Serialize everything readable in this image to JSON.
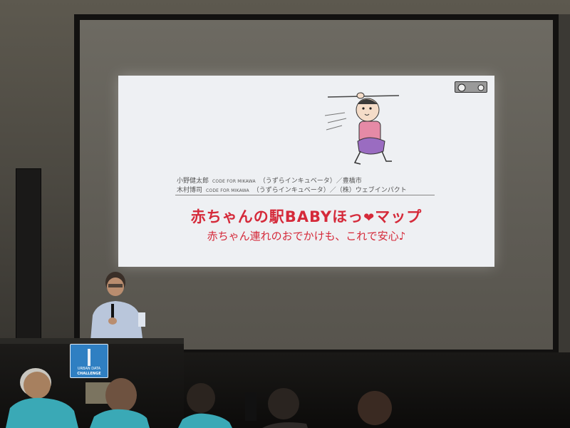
{
  "slide": {
    "credits": [
      {
        "name": "小野健太郎",
        "org": "CODE FOR MIKAWA",
        "rest": "（うずらインキュベータ）／豊橋市"
      },
      {
        "name": "木村博司",
        "org": "CODE FOR MIKAWA",
        "rest": "（うずらインキュベータ）／（株）ウェブインパクト"
      }
    ],
    "title_before": "赤ちゃんの駅BABYほっ",
    "title_heart": "❤",
    "title_after": "マップ",
    "subtitle": "赤ちゃん連れのおでかけも、これで安心♪"
  },
  "podium_logo": {
    "line1": "URBAN DATA",
    "line2": "CHALLENGE"
  },
  "colors": {
    "title_red": "#d52a3a",
    "logo_blue": "#2f7fc2",
    "shirt_teal": "#3aa9b6"
  },
  "icons": {
    "baby_illustration": "baby-illustration-icon",
    "cc_badge": "creative-commons-badge-icon"
  }
}
